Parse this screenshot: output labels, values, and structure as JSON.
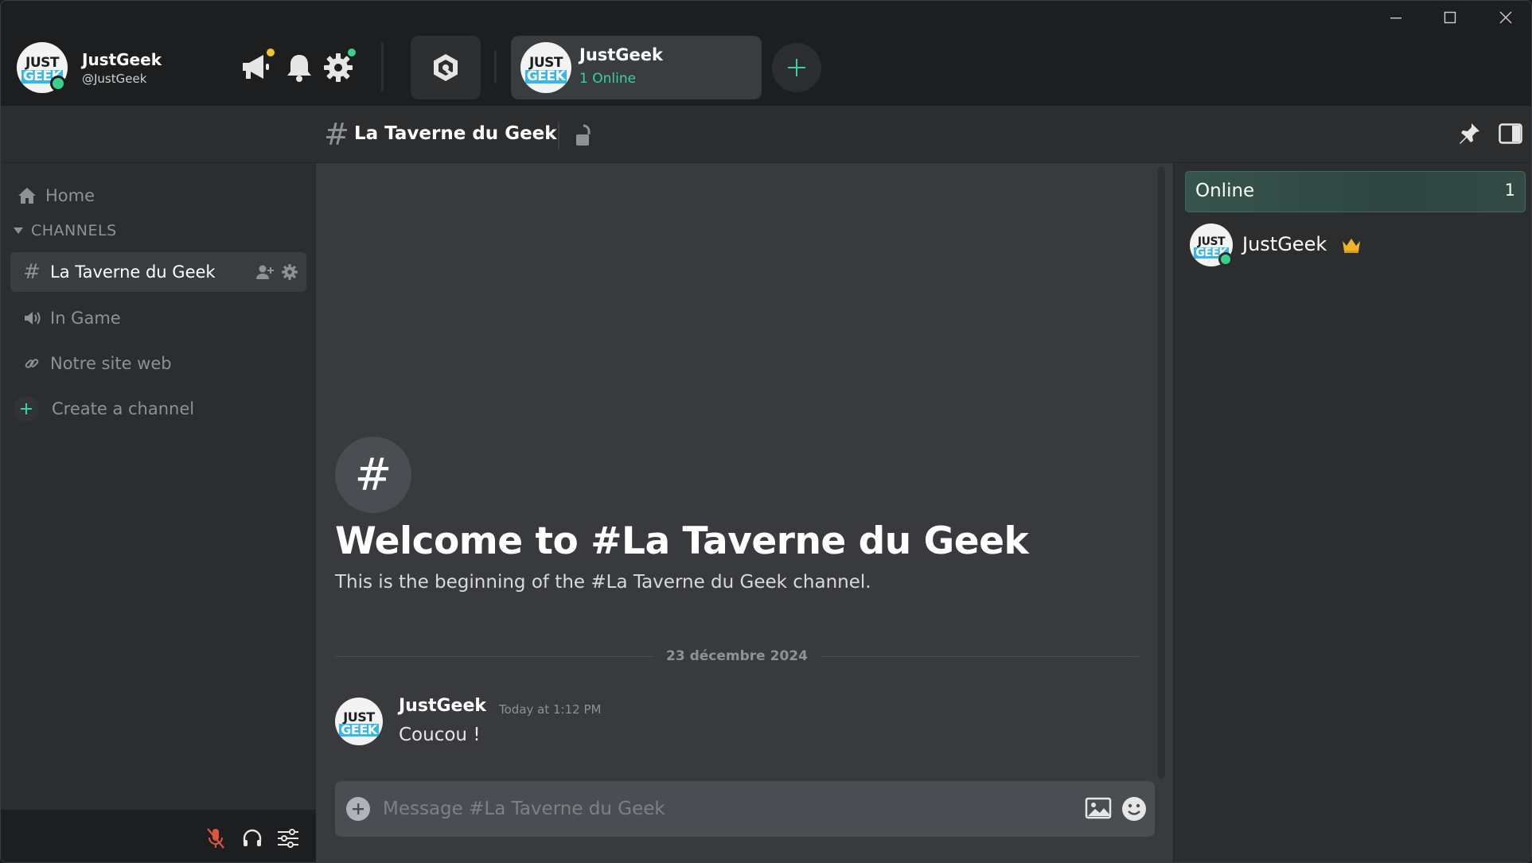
{
  "user": {
    "name": "JustGeek",
    "handle": "@JustGeek",
    "avatar": {
      "line1": "JUST",
      "line2": "GEEK"
    },
    "status": "online"
  },
  "toolbar": {
    "announcements_icon": "megaphone-icon",
    "notifications_icon": "bell-icon",
    "settings_icon": "gear-icon",
    "hub_icon": "hub-icon"
  },
  "server": {
    "name": "JustGeek",
    "online_text": "1 Online",
    "add_label": "+"
  },
  "window_controls": {
    "minimize": "—",
    "maximize": "☐",
    "close": "✕"
  },
  "channel_header": {
    "hash": "#",
    "title": "La Taverne du Geek"
  },
  "sidebar": {
    "home_label": "Home",
    "category_label": "CHANNELS",
    "channels": [
      {
        "label": "La Taverne du Geek",
        "type": "text",
        "active": true
      },
      {
        "label": "In Game",
        "type": "voice",
        "active": false
      },
      {
        "label": "Notre site web",
        "type": "link",
        "active": false
      }
    ],
    "create_channel_label": "Create a channel"
  },
  "main": {
    "welcome_icon": "#",
    "welcome_title": "Welcome to #La Taverne du Geek",
    "welcome_subtitle": "This is the beginning of the #La Taverne du Geek channel.",
    "date_separator": "23 décembre 2024",
    "messages": [
      {
        "author": "JustGeek",
        "time": "Today at 1:12 PM",
        "text": "Coucou !"
      }
    ],
    "composer_placeholder": "Message #La Taverne du Geek"
  },
  "members": {
    "online_label": "Online",
    "online_count": "1",
    "list": [
      {
        "name": "JustGeek",
        "badge": "crown-icon"
      }
    ]
  },
  "colors": {
    "accent": "#3ad0a0",
    "status_online": "#3ad08a",
    "mute_red": "#e0533d",
    "crown": "#f0b429"
  }
}
